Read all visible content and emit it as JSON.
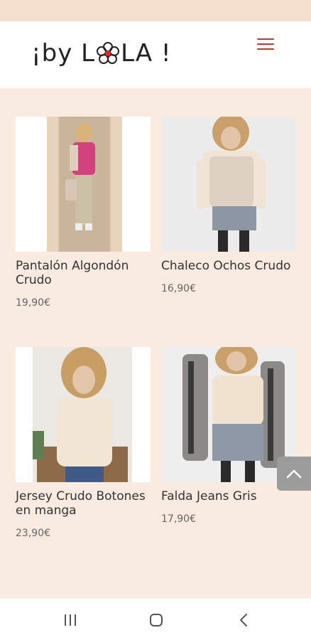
{
  "brand": {
    "logo_text": "¡by LOLA !",
    "logo_left": "¡by L",
    "logo_right": "LA !",
    "accent_color": "#c23a2c",
    "heart_color": "#e0262b"
  },
  "header": {
    "menu_icon": "hamburger-menu-icon"
  },
  "products": [
    {
      "title": "Pantalón Algondón Crudo",
      "price": "19,90€"
    },
    {
      "title": "Chaleco Ochos Crudo",
      "price": "16,90€"
    },
    {
      "title": "Jersey Crudo Botones en manga",
      "price": "23,90€"
    },
    {
      "title": "Falda Jeans Gris",
      "price": "17,90€"
    }
  ],
  "scroll_top": {
    "icon": "chevron-up-icon"
  },
  "nav_bar": {
    "recents_icon": "recents-icon",
    "home_icon": "home-icon",
    "back_icon": "back-icon"
  }
}
